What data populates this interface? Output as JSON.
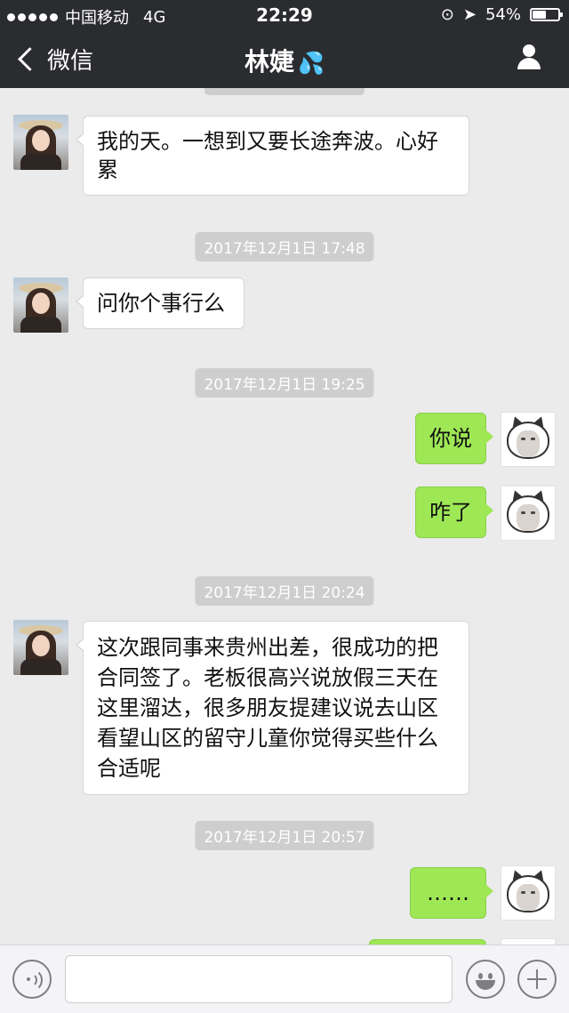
{
  "status_bar": {
    "carrier": "中国移动",
    "network": "4G",
    "time": "22:29",
    "battery": "54%",
    "battery_level": 0.54
  },
  "nav": {
    "back_label": "微信",
    "title": "林婕",
    "title_emoji": "💦"
  },
  "messages": [
    {
      "type": "incoming",
      "text": "我的天。一想到又要长途奔波。心好累"
    },
    {
      "type": "timestamp",
      "text": "2017年12月1日 17:48"
    },
    {
      "type": "incoming",
      "text": "问你个事行么"
    },
    {
      "type": "timestamp",
      "text": "2017年12月1日 19:25"
    },
    {
      "type": "outgoing",
      "text": "你说"
    },
    {
      "type": "outgoing",
      "text": "咋了"
    },
    {
      "type": "timestamp",
      "text": "2017年12月1日 20:24"
    },
    {
      "type": "incoming",
      "text": "这次跟同事来贵州出差，很成功的把合同签了。老板很高兴说放假三天在这里溜达，很多朋友提建议说去山区看望山区的留守儿童你觉得买些什么合适呢"
    },
    {
      "type": "timestamp",
      "text": "2017年12月1日 20:57"
    },
    {
      "type": "outgoing",
      "text": "……"
    }
  ],
  "colors": {
    "nav_background": "#2b2c30",
    "chat_background": "#ebebeb",
    "outgoing_bubble": "#9ee755",
    "incoming_bubble": "#ffffff",
    "timestamp_pill": "#cececf"
  },
  "icons": {
    "back": "chevron-left-icon",
    "profile": "person-icon",
    "voice": "voice-icon",
    "emoji": "emoji-icon",
    "plus": "plus-icon"
  }
}
